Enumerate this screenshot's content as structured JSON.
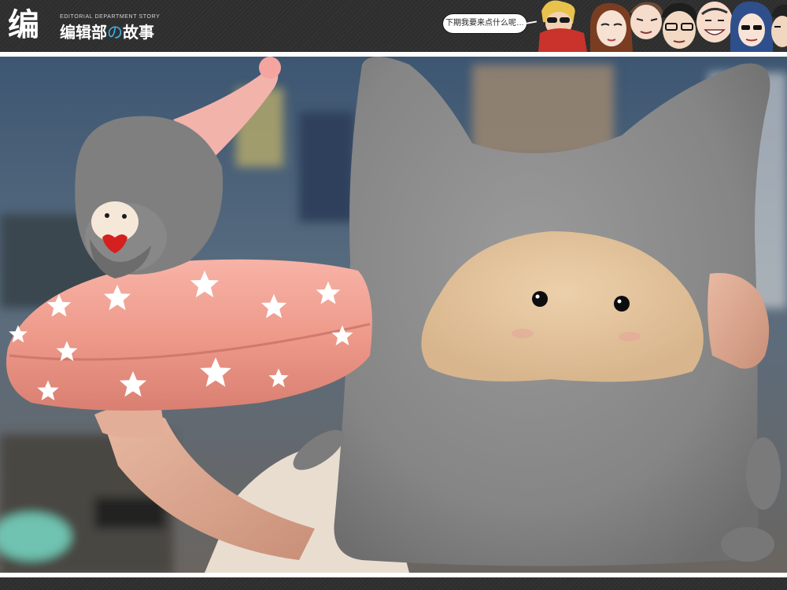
{
  "header": {
    "logo_mark": "编",
    "logo_tagline": "EDITORIAL DEPARTMENT STORY",
    "logo_title_before": "编辑部",
    "logo_title_accent": "の",
    "logo_title_after": "故事",
    "speech_bubble": "下期我要来点什么呢…"
  },
  "colors": {
    "header_bg": "#333333",
    "accent": "#3fb0e8",
    "pillow_gray": "#8c8c8c",
    "pillow_face": "#e3c39e",
    "cushion_pink": "#ef9a8c"
  },
  "photo": {
    "subject": "plush-toys"
  }
}
